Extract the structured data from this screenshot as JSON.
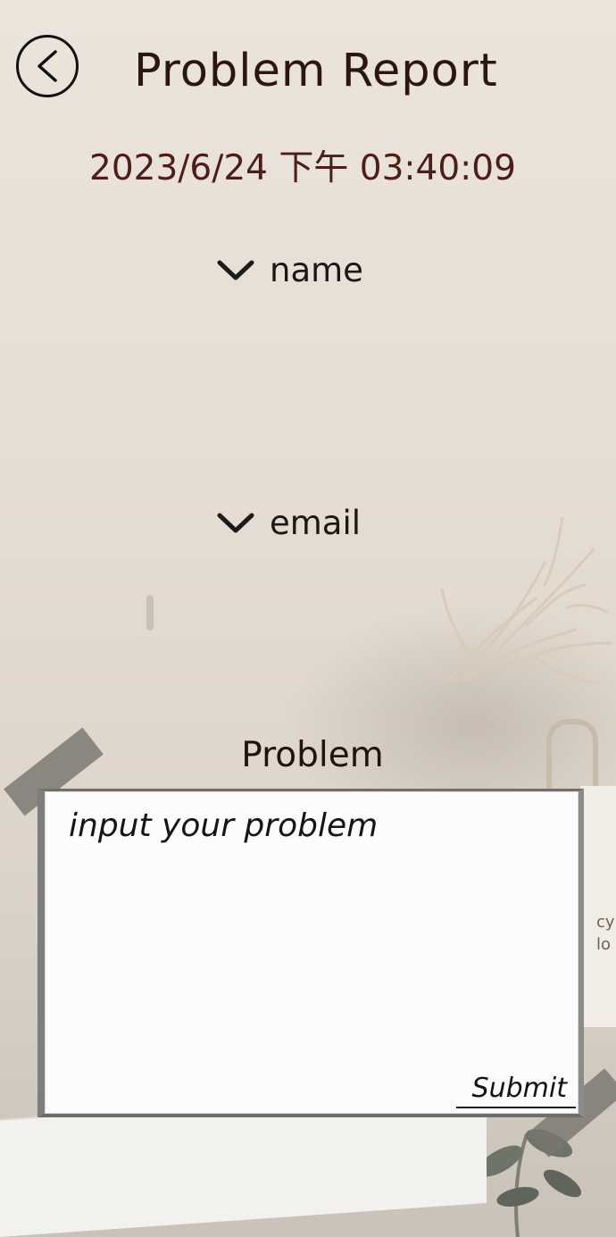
{
  "header": {
    "title": "Problem Report"
  },
  "meta": {
    "timestamp": "2023/6/24 下午 03:40:09"
  },
  "fields": {
    "name_label": "name",
    "email_label": "email"
  },
  "problem": {
    "label": "Problem",
    "placeholder": "input your problem",
    "submit_label": "Submit"
  },
  "background": {
    "bag_text": "cy\nlo"
  },
  "icons": {
    "back": "chevron-left-icon",
    "dropdown": "chevron-down-icon"
  },
  "colors": {
    "title": "#2d1512",
    "timestamp": "#4d1d18",
    "panel_border": "#7e7e7c",
    "panel_bg": "#fcfcfc"
  }
}
